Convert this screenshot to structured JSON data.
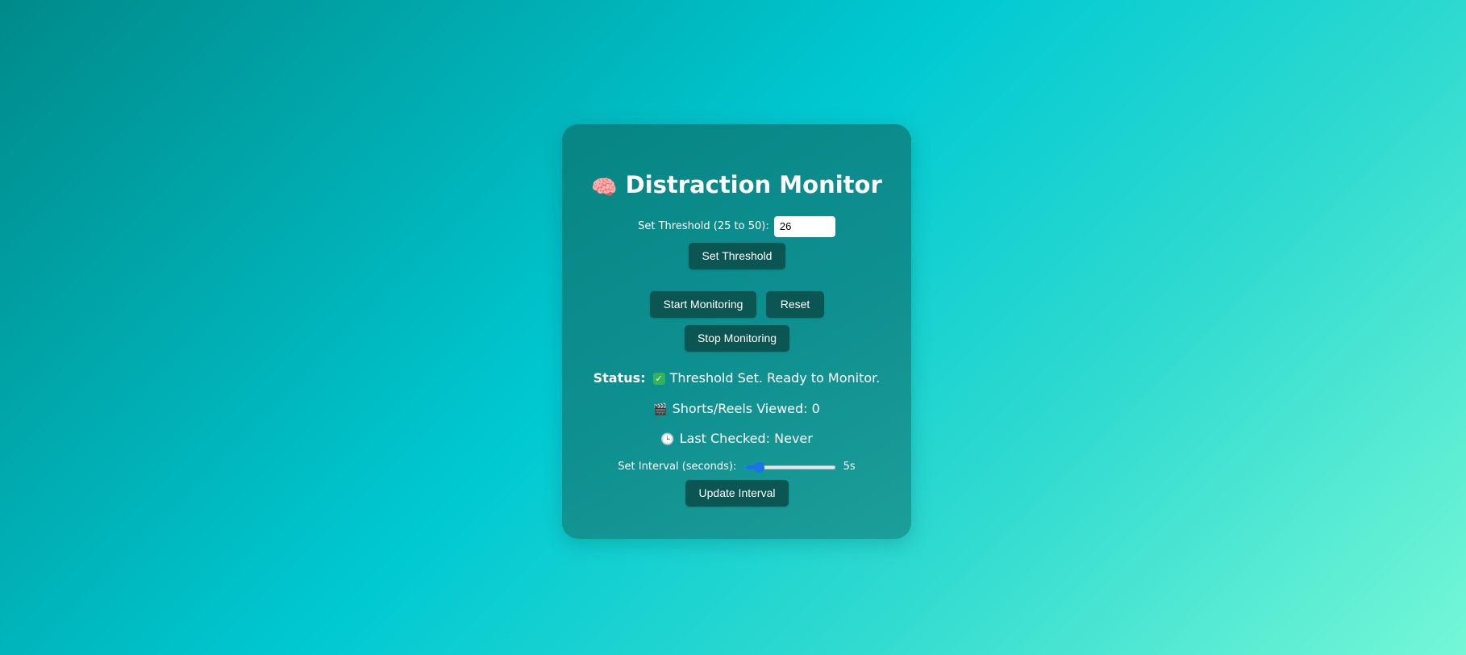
{
  "app": {
    "title": "Distraction Monitor",
    "title_icon": "brain-icon",
    "title_emoji": "🧠"
  },
  "threshold": {
    "label": "Set Threshold (25 to 50):",
    "value": "26",
    "button_label": "Set Threshold"
  },
  "controls": {
    "start_label": "Start Monitoring",
    "reset_label": "Reset",
    "stop_label": "Stop Monitoring"
  },
  "status": {
    "label": "Status:",
    "icon": "check-icon",
    "check_glyph": "✓",
    "text": "Threshold Set. Ready to Monitor."
  },
  "stats": {
    "shorts_icon": "clapper-icon",
    "shorts_emoji": "🎬",
    "shorts_text": "Shorts/Reels Viewed: 0",
    "checked_icon": "clock-icon",
    "checked_emoji": "🕒",
    "checked_text": "Last Checked: Never"
  },
  "interval": {
    "label": "Set Interval (seconds):",
    "slider_fraction": 0.1,
    "value_text": "5s",
    "button_label": "Update Interval"
  },
  "colors": {
    "button": "#0b5553",
    "slider_accent": "#1a73e8"
  }
}
